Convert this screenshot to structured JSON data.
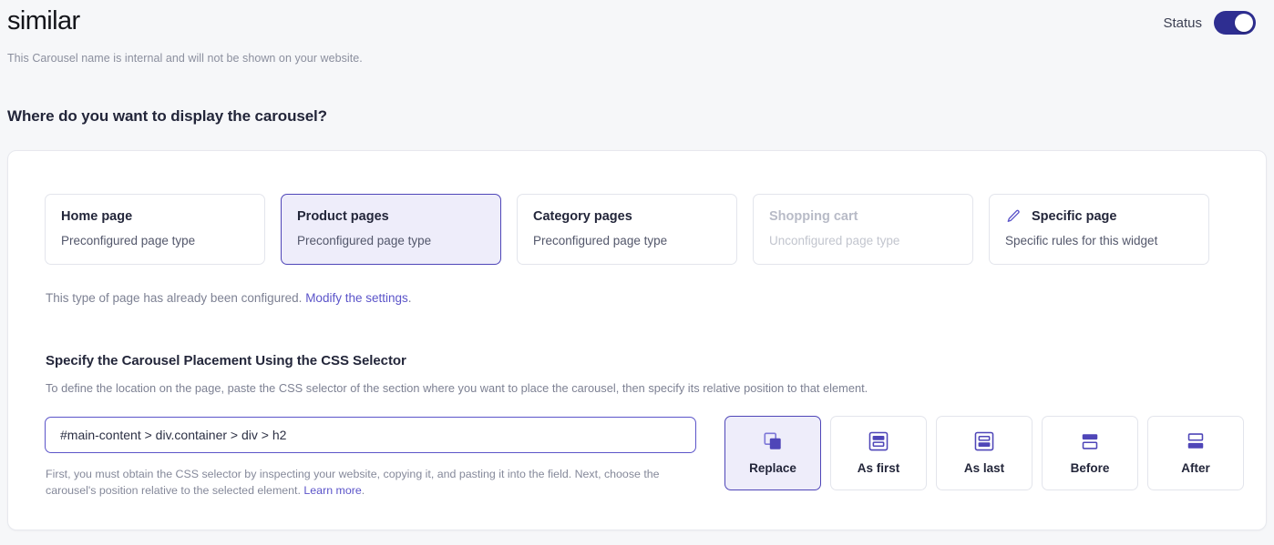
{
  "header": {
    "title": "similar",
    "title_placeholder": "Carousel name",
    "status_label": "Status",
    "status_on": true,
    "sub_note": "This Carousel name is internal and will not be shown on your website."
  },
  "section": {
    "heading": "Where do you want to display the carousel?"
  },
  "page_types": [
    {
      "title": "Home page",
      "subtitle": "Preconfigured page type",
      "state": "default",
      "icon": ""
    },
    {
      "title": "Product pages",
      "subtitle": "Preconfigured page type",
      "state": "selected",
      "icon": ""
    },
    {
      "title": "Category pages",
      "subtitle": "Preconfigured page type",
      "state": "default",
      "icon": ""
    },
    {
      "title": "Shopping cart",
      "subtitle": "Unconfigured page type",
      "state": "disabled",
      "icon": ""
    },
    {
      "title": "Specific page",
      "subtitle": "Specific rules for this widget",
      "state": "default",
      "icon": "pencil-icon"
    }
  ],
  "configured_note": {
    "text": "This type of page has already been configured. ",
    "link": "Modify the settings",
    "suffix": "."
  },
  "selector": {
    "heading": "Specify the Carousel Placement Using the CSS Selector",
    "description": "To define the location on the page, paste the CSS selector of the section where you want to place the carousel, then specify its relative position to that element.",
    "value": "#main-content > div.container > div > h2",
    "placeholder": "Paste the CSS selector here",
    "help_text": "First, you must obtain the CSS selector by inspecting your website, copying it, and pasting it into the field. Next, choose the carousel's position relative to the selected element. ",
    "help_link": "Learn more",
    "help_suffix": "."
  },
  "positions": [
    {
      "label": "Replace",
      "icon": "replace-icon",
      "state": "selected"
    },
    {
      "label": "As first",
      "icon": "as-first-icon",
      "state": "default"
    },
    {
      "label": "As last",
      "icon": "as-last-icon",
      "state": "default"
    },
    {
      "label": "Before",
      "icon": "before-icon",
      "state": "default"
    },
    {
      "label": "After",
      "icon": "after-icon",
      "state": "default"
    }
  ],
  "colors": {
    "accent": "#4f46b8",
    "accent_soft": "#eeedfa",
    "link": "#5b54c9",
    "toggle_on": "#2e2e91",
    "page_bg": "#f6f7f9",
    "panel_bg": "#ffffff",
    "border": "#e3e5ec",
    "text": "#23263a",
    "muted": "#7d8193",
    "disabled": "#b8bbc7"
  }
}
